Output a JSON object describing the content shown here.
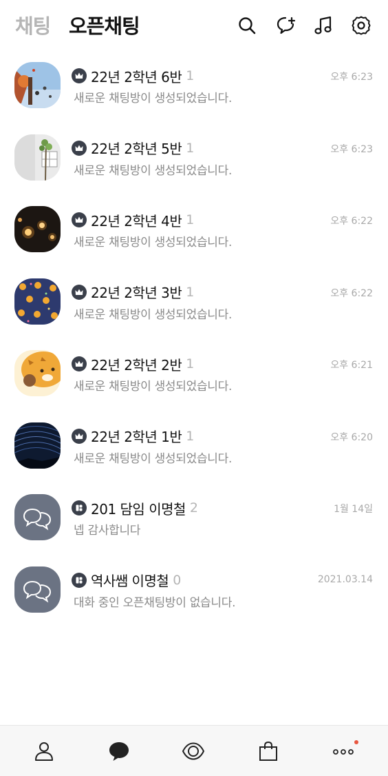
{
  "header": {
    "tabs": [
      {
        "label": "채팅",
        "active": false
      },
      {
        "label": "오픈채팅",
        "active": true
      }
    ],
    "icons": [
      "search-icon",
      "new-chat-icon",
      "music-icon",
      "settings-icon"
    ]
  },
  "chats": [
    {
      "title": "22년 2학년 6반",
      "count": "1",
      "preview": "새로운 채팅방이 생성되었습니다.",
      "time": "오후 6:23",
      "badge": "crown-icon"
    },
    {
      "title": "22년 2학년 5반",
      "count": "1",
      "preview": "새로운 채팅방이 생성되었습니다.",
      "time": "오후 6:23",
      "badge": "crown-icon"
    },
    {
      "title": "22년 2학년 4반",
      "count": "1",
      "preview": "새로운 채팅방이 생성되었습니다.",
      "time": "오후 6:22",
      "badge": "crown-icon"
    },
    {
      "title": "22년 2학년 3반",
      "count": "1",
      "preview": "새로운 채팅방이 생성되었습니다.",
      "time": "오후 6:22",
      "badge": "crown-icon"
    },
    {
      "title": "22년 2학년 2반",
      "count": "1",
      "preview": "새로운 채팅방이 생성되었습니다.",
      "time": "오후 6:21",
      "badge": "crown-icon"
    },
    {
      "title": "22년 2학년 1반",
      "count": "1",
      "preview": "새로운 채팅방이 생성되었습니다.",
      "time": "오후 6:20",
      "badge": "crown-icon"
    },
    {
      "title": "201 담임 이명철",
      "count": "2",
      "preview": "넵 감사합니다",
      "time": "1월 14일",
      "badge": "open-chat-icon"
    },
    {
      "title": "역사쌤 이명철",
      "count": "0",
      "preview": "대화 중인 오픈채팅방이 없습니다.",
      "time": "2021.03.14",
      "badge": "open-chat-icon"
    }
  ],
  "bottom_nav": {
    "items": [
      "friends-icon",
      "chats-icon",
      "view-icon",
      "shopping-icon",
      "more-icon"
    ],
    "notification_dot_color": "#e8563f"
  },
  "colors": {
    "badge_bg": "#3a3f4a",
    "default_avatar_bg": "#6b7383"
  }
}
